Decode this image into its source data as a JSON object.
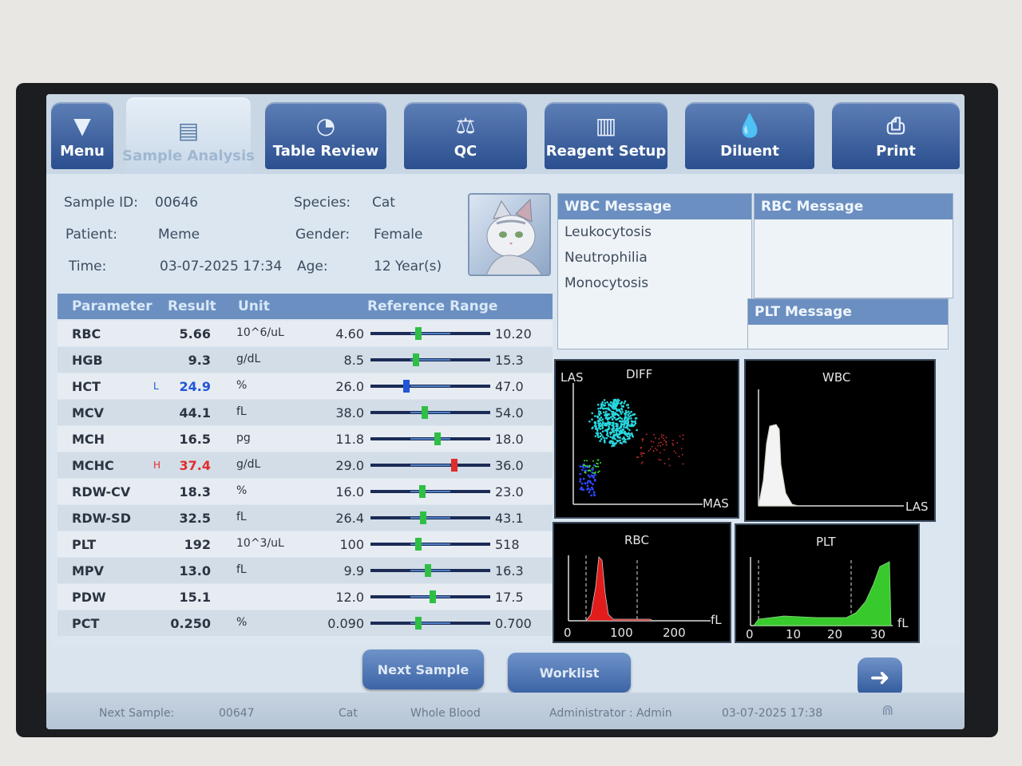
{
  "toolbar": {
    "tabs": [
      {
        "label": "Menu",
        "icon": "menu-triangle-icon"
      },
      {
        "label": "Sample Analysis",
        "icon": "sample-analysis-icon"
      },
      {
        "label": "Table Review",
        "icon": "table-review-icon"
      },
      {
        "label": "QC",
        "icon": "scale-icon"
      },
      {
        "label": "Reagent Setup",
        "icon": "reagent-icon"
      },
      {
        "label": "Diluent",
        "icon": "diluent-drop-icon"
      },
      {
        "label": "Print",
        "icon": "printer-icon"
      }
    ]
  },
  "sample": {
    "id_label": "Sample ID:",
    "id_value": "00646",
    "patient_label": "Patient:",
    "patient_value": "Meme",
    "time_label": "Time:",
    "time_value": "03-07-2025 17:34",
    "species_label": "Species:",
    "species_value": "Cat",
    "gender_label": "Gender:",
    "gender_value": "Female",
    "age_label": "Age:",
    "age_value": "12 Year(s)"
  },
  "table": {
    "headers": {
      "parameter": "Parameter",
      "result": "Result",
      "unit": "Unit",
      "range": "Reference Range"
    },
    "rows": [
      {
        "name": "RBC",
        "flag": "",
        "result": "5.66",
        "unit": "10^6/uL",
        "low": "4.60",
        "high": "10.20",
        "position": 0.4
      },
      {
        "name": "HGB",
        "flag": "",
        "result": "9.3",
        "unit": "g/dL",
        "low": "8.5",
        "high": "15.3",
        "position": 0.38
      },
      {
        "name": "HCT",
        "flag": "L",
        "result": "24.9",
        "unit": "%",
        "low": "26.0",
        "high": "47.0",
        "position": 0.3
      },
      {
        "name": "MCV",
        "flag": "",
        "result": "44.1",
        "unit": "fL",
        "low": "38.0",
        "high": "54.0",
        "position": 0.45
      },
      {
        "name": "MCH",
        "flag": "",
        "result": "16.5",
        "unit": "pg",
        "low": "11.8",
        "high": "18.0",
        "position": 0.56
      },
      {
        "name": "MCHC",
        "flag": "H",
        "result": "37.4",
        "unit": "g/dL",
        "low": "29.0",
        "high": "36.0",
        "position": 0.7
      },
      {
        "name": "RDW-CV",
        "flag": "",
        "result": "18.3",
        "unit": "%",
        "low": "16.0",
        "high": "23.0",
        "position": 0.43
      },
      {
        "name": "RDW-SD",
        "flag": "",
        "result": "32.5",
        "unit": "fL",
        "low": "26.4",
        "high": "43.1",
        "position": 0.44
      },
      {
        "name": "PLT",
        "flag": "",
        "result": "192",
        "unit": "10^3/uL",
        "low": "100",
        "high": "518",
        "position": 0.4
      },
      {
        "name": "MPV",
        "flag": "",
        "result": "13.0",
        "unit": "fL",
        "low": "9.9",
        "high": "16.3",
        "position": 0.48
      },
      {
        "name": "PDW",
        "flag": "",
        "result": "15.1",
        "unit": "",
        "low": "12.0",
        "high": "17.5",
        "position": 0.52
      },
      {
        "name": "PCT",
        "flag": "",
        "result": "0.250",
        "unit": "%",
        "low": "0.090",
        "high": "0.700",
        "position": 0.4
      }
    ]
  },
  "messages": {
    "wbc_title": "WBC Message",
    "wbc_items": [
      "Leukocytosis",
      "Neutrophilia",
      "Monocytosis"
    ],
    "rbc_title": "RBC Message",
    "plt_title": "PLT Message"
  },
  "graphs": {
    "diff": {
      "title": "DIFF",
      "y_label": "LAS",
      "x_label": "MAS"
    },
    "wbc": {
      "title": "WBC",
      "x_label": "LAS"
    },
    "rbc": {
      "title": "RBC",
      "unit": "fL",
      "ticks": [
        "0",
        "100",
        "200"
      ]
    },
    "plt": {
      "title": "PLT",
      "unit": "fL",
      "ticks": [
        "0",
        "10",
        "20",
        "30"
      ]
    }
  },
  "buttons": {
    "next_sample": "Next Sample",
    "worklist": "Worklist"
  },
  "status": {
    "next_sample_label": "Next Sample:",
    "next_sample_id": "00647",
    "species": "Cat",
    "sample_type": "Whole Blood",
    "user": "Administrator : Admin",
    "datetime": "03-07-2025 17:38"
  },
  "colors": {
    "header_blue": "#6b8fc1",
    "low_flag": "#2255d8",
    "high_flag": "#e02d2d",
    "marker_green": "#2fbf45",
    "diff_cyan": "#27d8e0",
    "rbc_red": "#e21b1b",
    "plt_green": "#38c92c",
    "wbc_white": "#f3f3f3"
  }
}
